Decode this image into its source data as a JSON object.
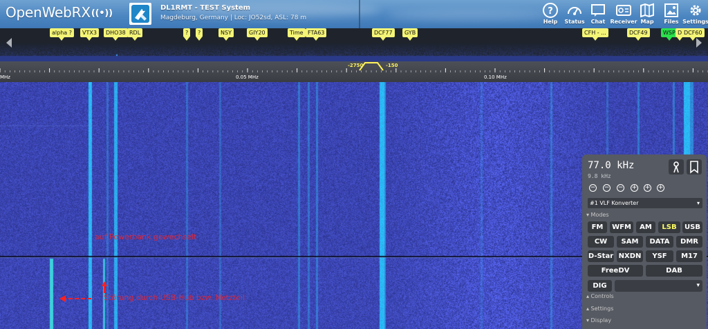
{
  "header": {
    "logo_text": "OpenWebRX",
    "receiver_title": "DL1RMT - TEST System",
    "receiver_desc": "Magdeburg, Germany | Loc: JO52sd, ASL: 78 m",
    "nav": [
      {
        "label": "Help",
        "icon": "help-icon"
      },
      {
        "label": "Status",
        "icon": "gauge-icon"
      },
      {
        "label": "Chat",
        "icon": "chat-icon"
      },
      {
        "label": "Receiver",
        "icon": "receiver-icon"
      },
      {
        "label": "Map",
        "icon": "map-icon"
      },
      {
        "label": "Files",
        "icon": "image-icon"
      },
      {
        "label": "Settings",
        "icon": "gear-icon"
      }
    ]
  },
  "bookmarks": [
    "alpha ?",
    "VTX3",
    "DHO38",
    "RDL",
    "?",
    "?",
    "NSY",
    "GIY20",
    "Time",
    "FTA63",
    "DCF77",
    "GYB",
    "CFH - ...",
    "DCF49",
    "WSP",
    "D",
    "DCF60"
  ],
  "scale": {
    "labels": [
      "MHz",
      "0.05 MHz",
      "0.10 MHz"
    ],
    "filter_low": "-2750",
    "filter_high": "-150"
  },
  "waterfall": {
    "annotation_1": "auf Powerbank gewechselt",
    "annotation_2": "Störung durch USB-Hub bzw. Netzteil"
  },
  "panel": {
    "frequency": "77.0 kHz",
    "bandwidth": "9.8 kHz",
    "zoom_buttons": [
      "−",
      "−",
      "−",
      "+",
      "+",
      "+"
    ],
    "profile": "#1 VLF Konverter",
    "modes_heading": "▾ Modes",
    "modes_row1": [
      "FM",
      "WFM",
      "AM",
      "LSB",
      "USB"
    ],
    "modes_row2": [
      "CW",
      "SAM",
      "DATA",
      "DMR"
    ],
    "modes_row3": [
      "D-Star",
      "NXDN",
      "YSF",
      "M17"
    ],
    "modes_row4": [
      "FreeDV",
      "DAB"
    ],
    "dig_label": "DIG",
    "active_mode": "LSB",
    "controls_heading": "▴ Controls",
    "settings_heading": "▴ Settings",
    "display_heading": "▾ Display"
  },
  "colors": {
    "bookmark": "#f4f476",
    "bookmark_active": "#2ce04c",
    "active_mode": "#ffff63",
    "waterfall_base": "#1b1f6e"
  }
}
